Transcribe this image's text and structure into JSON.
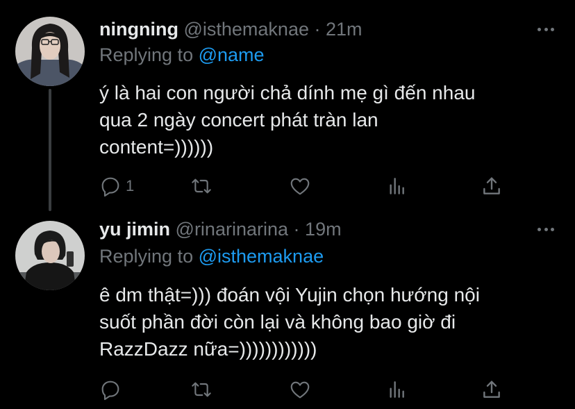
{
  "tweets": [
    {
      "name": "ningning",
      "handle": "@isthemaknae",
      "separator": "·",
      "time": "21m",
      "replying_prefix": "Replying to",
      "replying_to": "@name",
      "text_lines": [
        "ý là hai con người chả dính mẹ gì đến nhau",
        "qua 2 ngày concert phát tràn lan",
        "content=))))))"
      ],
      "reply_count": "1",
      "icons": [
        "reply-icon",
        "retweet-icon",
        "like-icon",
        "stats-icon",
        "share-icon",
        "more-icon"
      ]
    },
    {
      "name": "yu jimin",
      "handle": "@rinarinarina",
      "separator": "·",
      "time": "19m",
      "replying_prefix": "Replying to",
      "replying_to": "@isthemaknae",
      "text_lines": [
        "ê dm thật=))) đoán vội Yujin chọn hướng nội",
        "suốt phần đời còn lại và không bao giờ đi",
        "RazzDazz nữa=))))))))))))"
      ],
      "reply_count": "",
      "icons": [
        "reply-icon",
        "retweet-icon",
        "like-icon",
        "stats-icon",
        "share-icon",
        "more-icon"
      ]
    }
  ],
  "colors": {
    "background": "#000000",
    "text": "#e7e9ea",
    "secondary": "#71767b",
    "accent": "#1d9bf0",
    "thread_line": "#3a3d40"
  }
}
